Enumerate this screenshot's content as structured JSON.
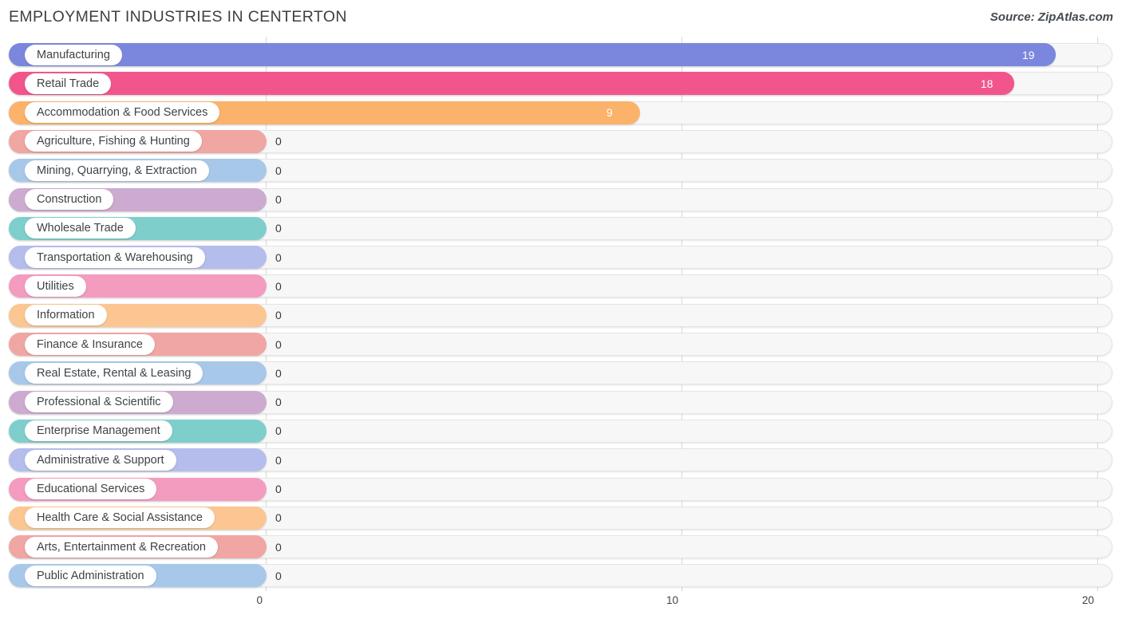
{
  "header": {
    "title": "EMPLOYMENT INDUSTRIES IN CENTERTON",
    "source": "Source: ZipAtlas.com"
  },
  "axis": {
    "ticks": [
      {
        "label": "0",
        "value": 0
      },
      {
        "label": "10",
        "value": 10
      },
      {
        "label": "20",
        "value": 20
      }
    ]
  },
  "chart_data": {
    "type": "bar",
    "orientation": "horizontal",
    "title": "EMPLOYMENT INDUSTRIES IN CENTERTON",
    "xlabel": "",
    "ylabel": "",
    "xlim": [
      0,
      20
    ],
    "grid": true,
    "legend": "none",
    "categories": [
      "Manufacturing",
      "Retail Trade",
      "Accommodation & Food Services",
      "Agriculture, Fishing & Hunting",
      "Mining, Quarrying, & Extraction",
      "Construction",
      "Wholesale Trade",
      "Transportation & Warehousing",
      "Utilities",
      "Information",
      "Finance & Insurance",
      "Real Estate, Rental & Leasing",
      "Professional & Scientific",
      "Enterprise Management",
      "Administrative & Support",
      "Educational Services",
      "Health Care & Social Assistance",
      "Arts, Entertainment & Recreation",
      "Public Administration"
    ],
    "values": [
      19,
      18,
      9,
      0,
      0,
      0,
      0,
      0,
      0,
      0,
      0,
      0,
      0,
      0,
      0,
      0,
      0,
      0,
      0
    ],
    "value_labels": [
      "19",
      "18",
      "9",
      "0",
      "0",
      "0",
      "0",
      "0",
      "0",
      "0",
      "0",
      "0",
      "0",
      "0",
      "0",
      "0",
      "0",
      "0",
      "0"
    ],
    "colors": [
      "#7b87dd",
      "#f2558c",
      "#fbb26a",
      "#f0a6a3",
      "#a8c8ea",
      "#cdaacf",
      "#7ecfcc",
      "#b4bdec",
      "#f49bc0",
      "#fbc691",
      "#f0a6a3",
      "#a8c8ea",
      "#cdaacf",
      "#7ecfcc",
      "#b4bdec",
      "#f49bc0",
      "#fbc691",
      "#f0a6a3",
      "#a8c8ea"
    ],
    "zero_bar_display_width_units": 0.38
  }
}
